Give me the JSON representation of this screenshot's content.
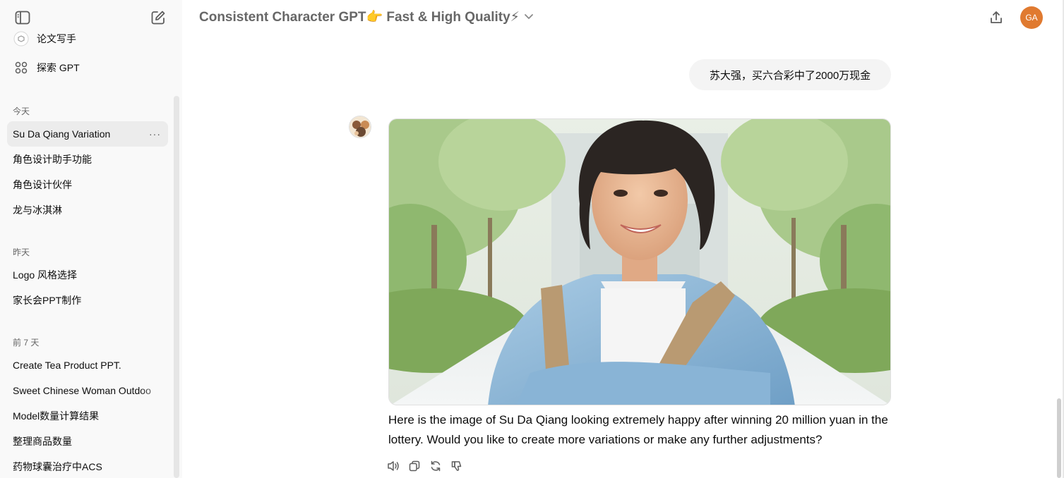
{
  "sidebar": {
    "gpts": [
      {
        "label": "论文写手",
        "icon": "gpt-avatar-icon"
      },
      {
        "label": "探索 GPT",
        "icon": "grid-icon"
      }
    ],
    "sections": [
      {
        "label": "今天",
        "items": [
          {
            "label": "Su Da Qiang Variation",
            "active": true
          },
          {
            "label": "角色设计助手功能"
          },
          {
            "label": "角色设计伙伴"
          },
          {
            "label": "龙与冰淇淋"
          }
        ]
      },
      {
        "label": "昨天",
        "items": [
          {
            "label": "Logo 风格选择"
          },
          {
            "label": "家长会PPT制作"
          }
        ]
      },
      {
        "label": "前 7 天",
        "items": [
          {
            "label": "Create Tea Product PPT."
          },
          {
            "label": "Sweet Chinese Woman Outdoo"
          },
          {
            "label": "Model数量计算结果"
          },
          {
            "label": "整理商品数量"
          },
          {
            "label": "药物球囊治疗中ACS"
          }
        ]
      }
    ],
    "more_label": "···"
  },
  "header": {
    "title": "Consistent Character GPT👉 Fast & High Quality⚡",
    "chevron": "⌄",
    "avatar_initials": "GA"
  },
  "conversation": {
    "user_message": "苏大强，买六合彩中了2000万现金",
    "assistant_text": "Here is the image of Su Da Qiang looking extremely happy after winning 20 million yuan in the lottery. Would you like to create more variations or make any further adjustments?"
  },
  "colors": {
    "sidebar_bg": "#f9f9f9",
    "active_item_bg": "#ececec",
    "avatar_bg": "#e07a30",
    "user_bubble_bg": "#f4f4f4"
  }
}
